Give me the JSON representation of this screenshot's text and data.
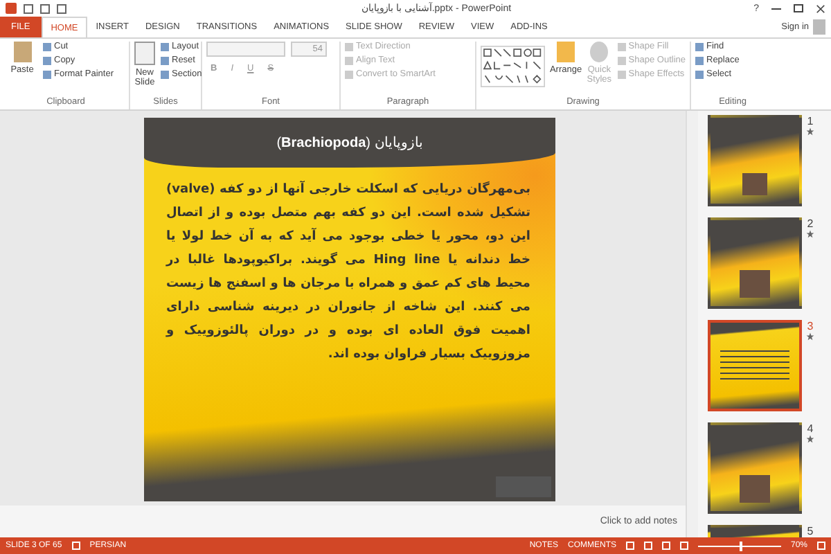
{
  "window": {
    "title": "آشنایی با بازوپایان.pptx - PowerPoint",
    "help": "?",
    "sign_in": "Sign in"
  },
  "tabs": [
    {
      "label": "FILE",
      "kind": "file",
      "selected": false
    },
    {
      "label": "HOME",
      "kind": "tab",
      "selected": true
    },
    {
      "label": "INSERT",
      "kind": "tab",
      "selected": false
    },
    {
      "label": "DESIGN",
      "kind": "tab",
      "selected": false
    },
    {
      "label": "TRANSITIONS",
      "kind": "tab",
      "selected": false
    },
    {
      "label": "ANIMATIONS",
      "kind": "tab",
      "selected": false
    },
    {
      "label": "SLIDE SHOW",
      "kind": "tab",
      "selected": false
    },
    {
      "label": "REVIEW",
      "kind": "tab",
      "selected": false
    },
    {
      "label": "VIEW",
      "kind": "tab",
      "selected": false
    },
    {
      "label": "ADD-INS",
      "kind": "tab",
      "selected": false
    }
  ],
  "ribbon": {
    "clipboard": {
      "label": "Clipboard",
      "large": "Paste",
      "small": [
        {
          "label": "Cut",
          "disabled": false
        },
        {
          "label": "Copy",
          "disabled": false
        },
        {
          "label": "Format Painter",
          "disabled": false
        }
      ]
    },
    "slides": {
      "label": "Slides",
      "large": "New Slide",
      "small": [
        {
          "label": "Layout",
          "disabled": false
        },
        {
          "label": "Reset",
          "disabled": false
        },
        {
          "label": "Section",
          "disabled": false
        }
      ]
    },
    "font": {
      "label": "Font",
      "size": "54",
      "buttons": [
        "B",
        "I",
        "U",
        "S"
      ]
    },
    "paragraph": {
      "label": "Paragraph",
      "small": [
        {
          "label": "Text Direction",
          "disabled": true
        },
        {
          "label": "Align Text",
          "disabled": true
        },
        {
          "label": "Convert to SmartArt",
          "disabled": true
        }
      ]
    },
    "drawing": {
      "label": "Drawing",
      "large": [
        {
          "label": "Arrange",
          "disabled": false
        },
        {
          "label": "Quick Styles",
          "disabled": true
        }
      ],
      "small": [
        {
          "label": "Shape Fill",
          "disabled": true
        },
        {
          "label": "Shape Outline",
          "disabled": true
        },
        {
          "label": "Shape Effects",
          "disabled": true
        }
      ]
    },
    "editing": {
      "label": "Editing",
      "small": [
        {
          "label": "Find",
          "disabled": false
        },
        {
          "label": "Replace",
          "disabled": false
        },
        {
          "label": "Select",
          "disabled": false
        }
      ]
    }
  },
  "slide": {
    "title": "بازوپایان (**Brachiopoda**)",
    "body": "بی‌مهرگان دریایی که اسکلت خارجی آنها از دو کفه (**valve**) تشکیل شده است. این دو کفه بهم متصل بوده و از اتصال این دو، محور یا خطی بوجود می آید که به آن خط لولا یا خط دندانه یا **Hing line** می گویند. براکیوپودها غالبا در محیط های کم عمق و همراه با مرجان ها و اسفنج ها زیست می کنند. این شاخه از جانوران در دیرینه شناسی دارای اهمیت فوق العاده ای بوده و در دوران پالئوزوییک و مزوزوییک بسیار فراوان بوده اند."
  },
  "thumbnails": [
    {
      "number": "1",
      "selected": false,
      "kind": "title"
    },
    {
      "number": "2",
      "selected": false,
      "kind": "photo"
    },
    {
      "number": "3",
      "selected": true,
      "kind": "text"
    },
    {
      "number": "4",
      "selected": false,
      "kind": "photo"
    },
    {
      "number": "5",
      "selected": false,
      "kind": "text"
    }
  ],
  "notes": {
    "placeholder": "Click to add notes"
  },
  "status_bar": {
    "slide": "SLIDE 3 OF 65",
    "language": "PERSIAN",
    "notes": "NOTES",
    "comments": "COMMENTS",
    "zoom": "70%",
    "level": 0.5
  }
}
